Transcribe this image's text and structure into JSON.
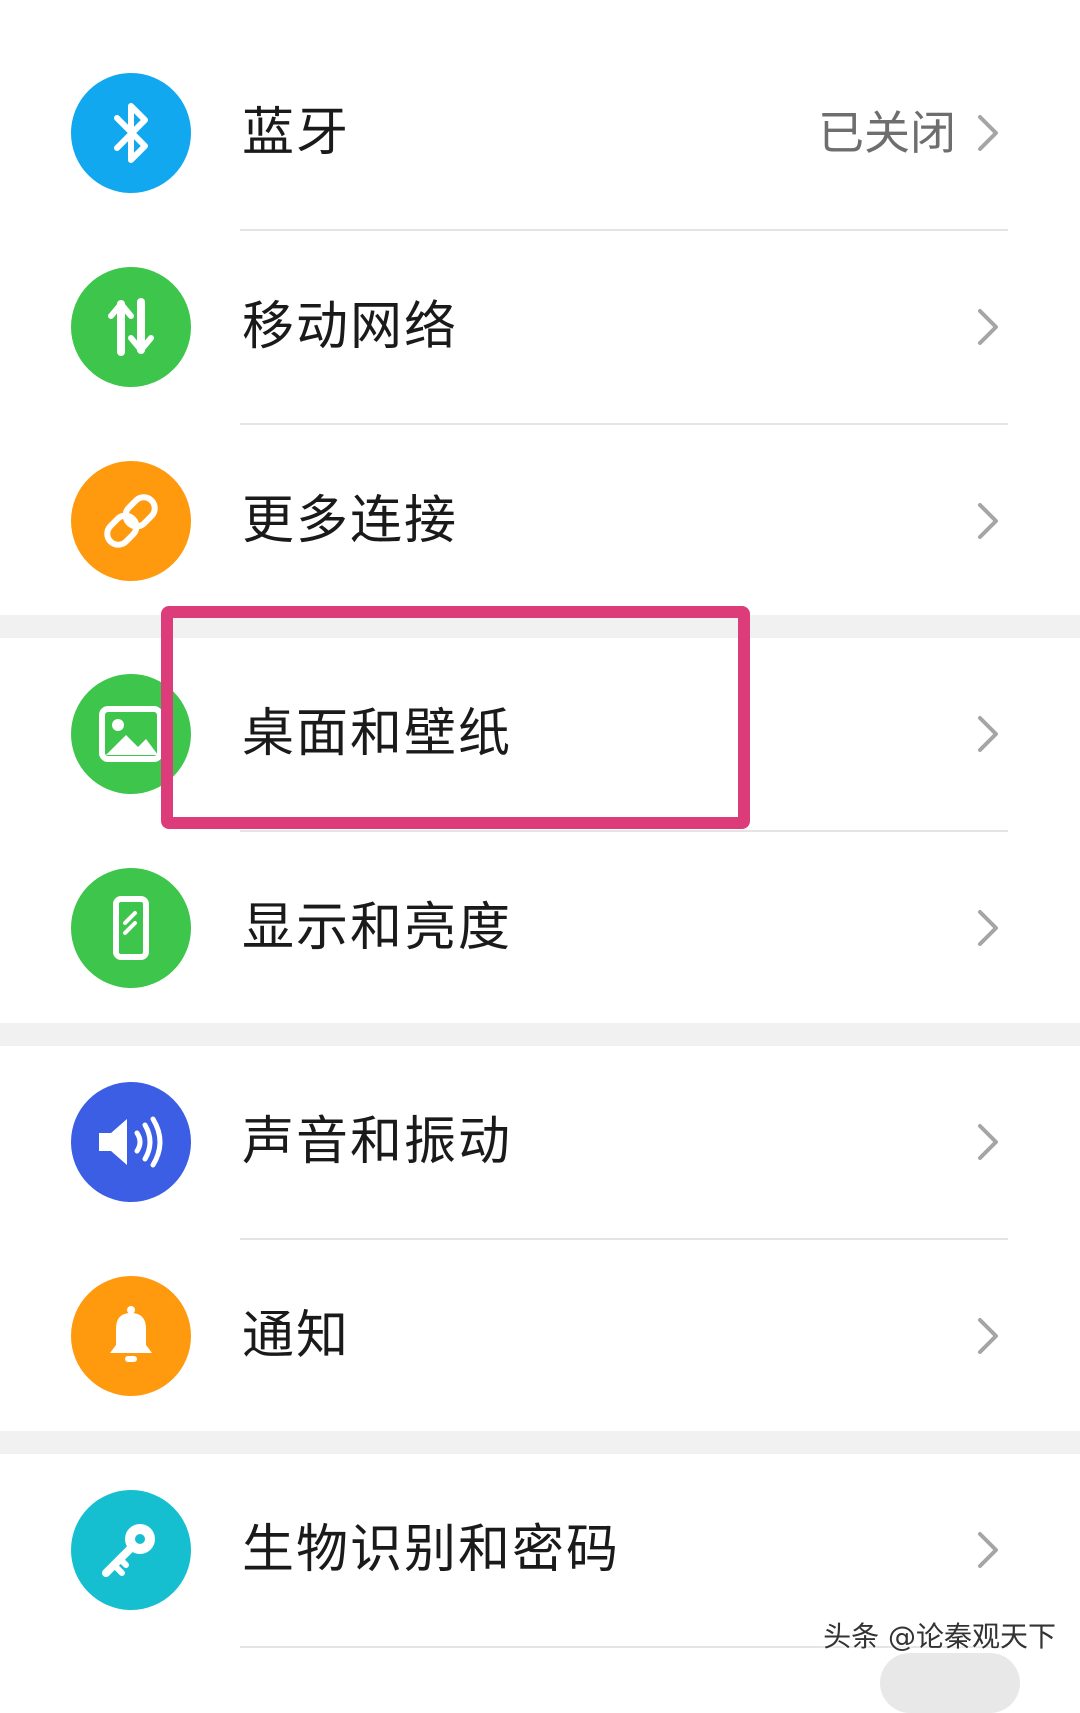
{
  "settings": {
    "items": [
      {
        "label": "蓝牙",
        "status": "已关闭",
        "icon": "bluetooth-icon",
        "color": "#11a8ef"
      },
      {
        "label": "移动网络",
        "icon": "mobile-data-icon",
        "color": "#3dc54c"
      },
      {
        "label": "更多连接",
        "icon": "link-icon",
        "color": "#ff9a0f"
      },
      {
        "label": "桌面和壁纸",
        "icon": "wallpaper-icon",
        "color": "#3dc54c"
      },
      {
        "label": "显示和亮度",
        "icon": "display-icon",
        "color": "#3dc54c"
      },
      {
        "label": "声音和振动",
        "icon": "volume-icon",
        "color": "#3b5ee5"
      },
      {
        "label": "通知",
        "icon": "bell-icon",
        "color": "#ff9a0f"
      },
      {
        "label": "生物识别和密码",
        "icon": "key-icon",
        "color": "#16bfd0"
      }
    ]
  },
  "highlight": {
    "target": "桌面和壁纸",
    "color": "#dc3d7a"
  },
  "watermark": "头条 @论秦观天下"
}
